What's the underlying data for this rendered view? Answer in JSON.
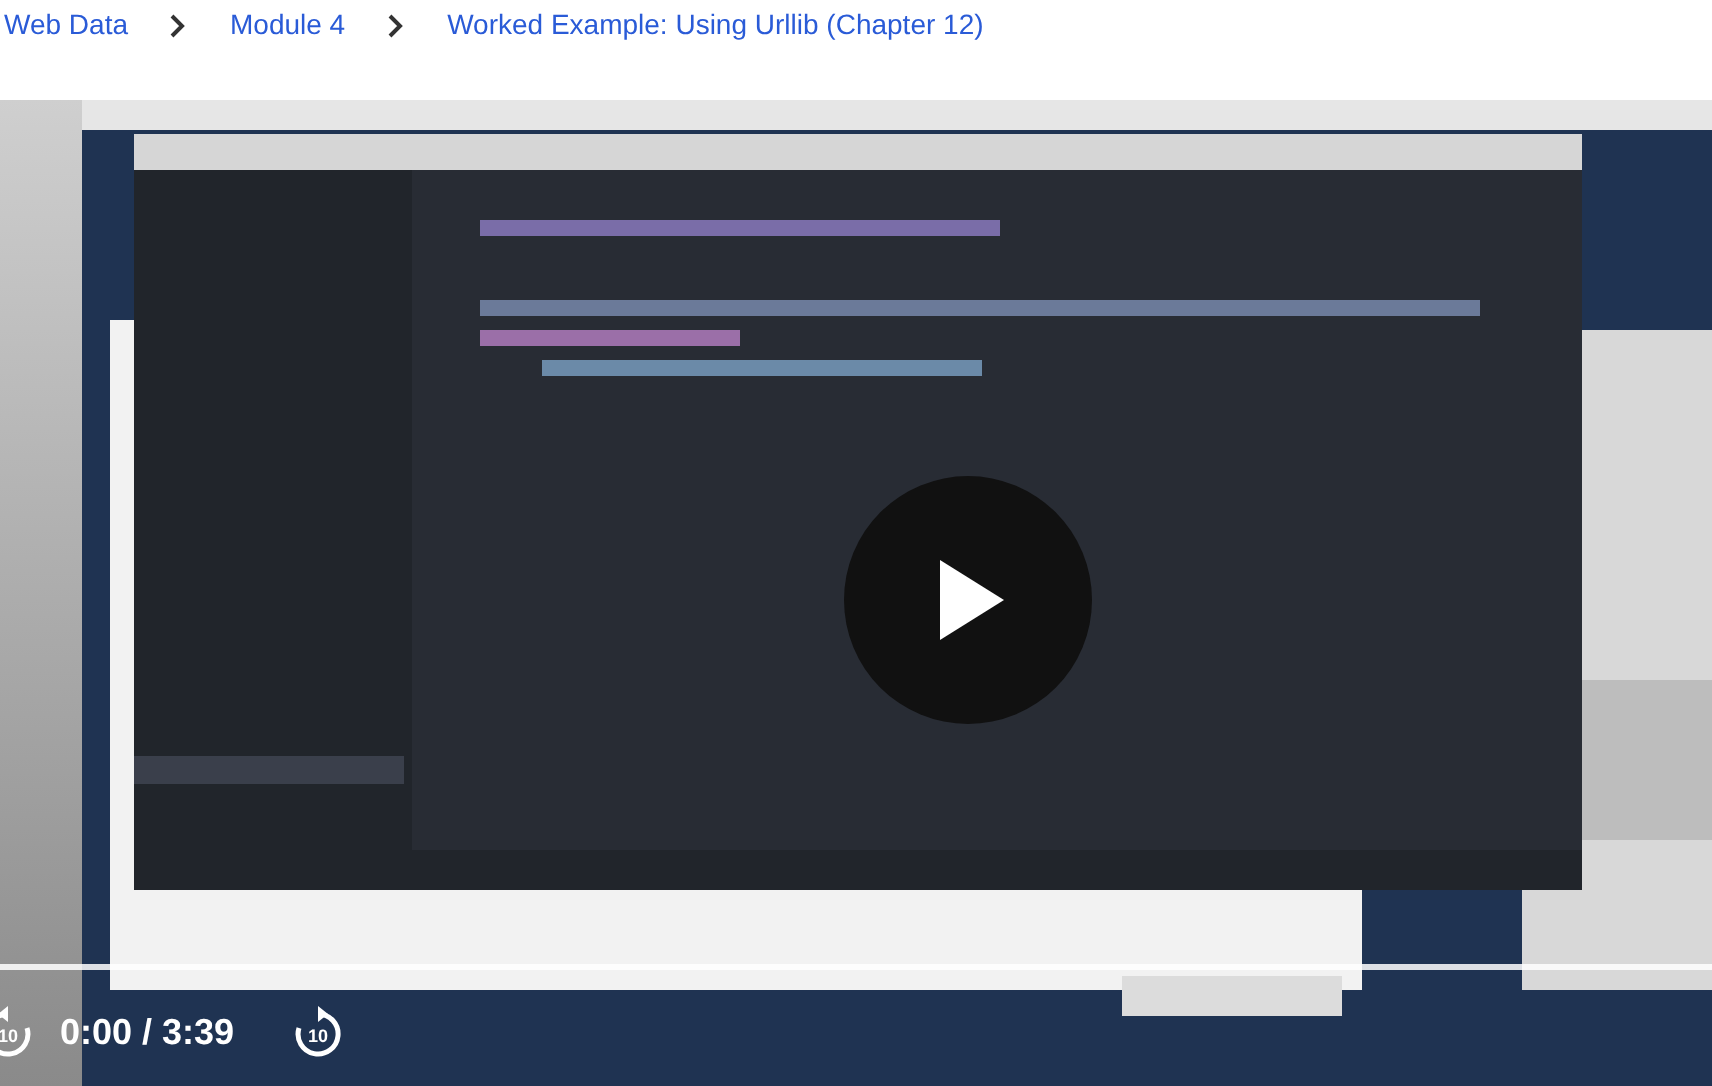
{
  "breadcrumb": [
    {
      "label": "Web Data"
    },
    {
      "label": "Module 4"
    },
    {
      "label": "Worked Example: Using Urllib (Chapter 12)"
    }
  ],
  "video": {
    "kind": "picture",
    "rewind_label": "10",
    "forward_label": "10",
    "time": "0:00 / 3:39"
  }
}
